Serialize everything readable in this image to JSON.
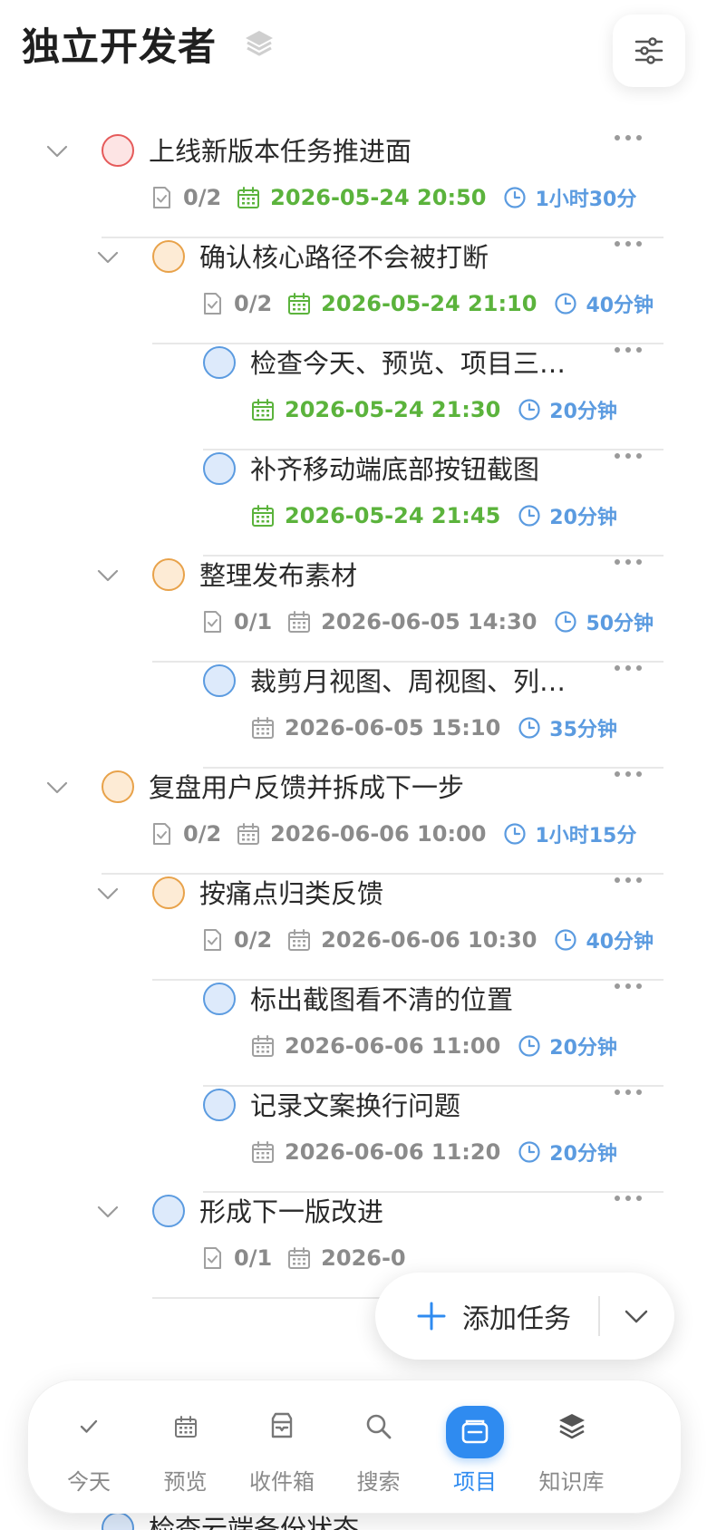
{
  "header": {
    "title": "独立开发者"
  },
  "tasks": [
    {
      "name": "上线新版本任务推进面",
      "level": 0,
      "circle": "red",
      "chevron": true,
      "subcount": "0/2",
      "date": "2026-05-24 20:50",
      "date_color": "green",
      "duration": "1小时30分"
    },
    {
      "name": "确认核心路径不会被打断",
      "level": 1,
      "circle": "orange",
      "chevron": true,
      "subcount": "0/2",
      "date": "2026-05-24 21:10",
      "date_color": "green",
      "duration": "40分钟"
    },
    {
      "name": "检查今天、预览、项目三…",
      "level": 2,
      "circle": "blue",
      "chevron": false,
      "subcount": "",
      "date": "2026-05-24 21:30",
      "date_color": "green",
      "duration": "20分钟"
    },
    {
      "name": "补齐移动端底部按钮截图",
      "level": 2,
      "circle": "blue",
      "chevron": false,
      "subcount": "",
      "date": "2026-05-24 21:45",
      "date_color": "green",
      "duration": "20分钟"
    },
    {
      "name": "整理发布素材",
      "level": 1,
      "circle": "orange",
      "chevron": true,
      "subcount": "0/1",
      "date": "2026-06-05 14:30",
      "date_color": "gray",
      "duration": "50分钟"
    },
    {
      "name": "裁剪月视图、周视图、列…",
      "level": 2,
      "circle": "blue",
      "chevron": false,
      "subcount": "",
      "date": "2026-06-05 15:10",
      "date_color": "gray",
      "duration": "35分钟"
    },
    {
      "name": "复盘用户反馈并拆成下一步",
      "level": 0,
      "circle": "orange",
      "chevron": true,
      "subcount": "0/2",
      "date": "2026-06-06 10:00",
      "date_color": "gray",
      "duration": "1小时15分"
    },
    {
      "name": "按痛点归类反馈",
      "level": 1,
      "circle": "orange",
      "chevron": true,
      "subcount": "0/2",
      "date": "2026-06-06 10:30",
      "date_color": "gray",
      "duration": "40分钟"
    },
    {
      "name": "标出截图看不清的位置",
      "level": 2,
      "circle": "blue",
      "chevron": false,
      "subcount": "",
      "date": "2026-06-06 11:00",
      "date_color": "gray",
      "duration": "20分钟"
    },
    {
      "name": "记录文案换行问题",
      "level": 2,
      "circle": "blue",
      "chevron": false,
      "subcount": "",
      "date": "2026-06-06 11:20",
      "date_color": "gray",
      "duration": "20分钟"
    },
    {
      "name": "形成下一版改进",
      "level": 1,
      "circle": "blue",
      "chevron": true,
      "subcount": "0/1",
      "date": "2026-0",
      "date_color": "gray",
      "duration": ""
    }
  ],
  "peek_task": {
    "name": "检查云端备份状态"
  },
  "fab": {
    "add_label": "添加任务"
  },
  "tabs": [
    {
      "label": "今天",
      "icon": "check-icon",
      "active": false
    },
    {
      "label": "预览",
      "icon": "calendar-icon",
      "active": false
    },
    {
      "label": "收件箱",
      "icon": "inbox-icon",
      "active": false
    },
    {
      "label": "搜索",
      "icon": "search-icon",
      "active": false
    },
    {
      "label": "项目",
      "icon": "project-icon",
      "active": true
    },
    {
      "label": "知识库",
      "icon": "layers-icon",
      "active": false
    }
  ],
  "colors": {
    "accent": "#2f8bf0",
    "date_green": "#5bb33c",
    "date_gray": "#8b8b8b",
    "duration_blue": "#5b9be0",
    "circle_red": "#e55a5a",
    "circle_orange": "#e8a24a",
    "circle_blue": "#5b9be0"
  }
}
